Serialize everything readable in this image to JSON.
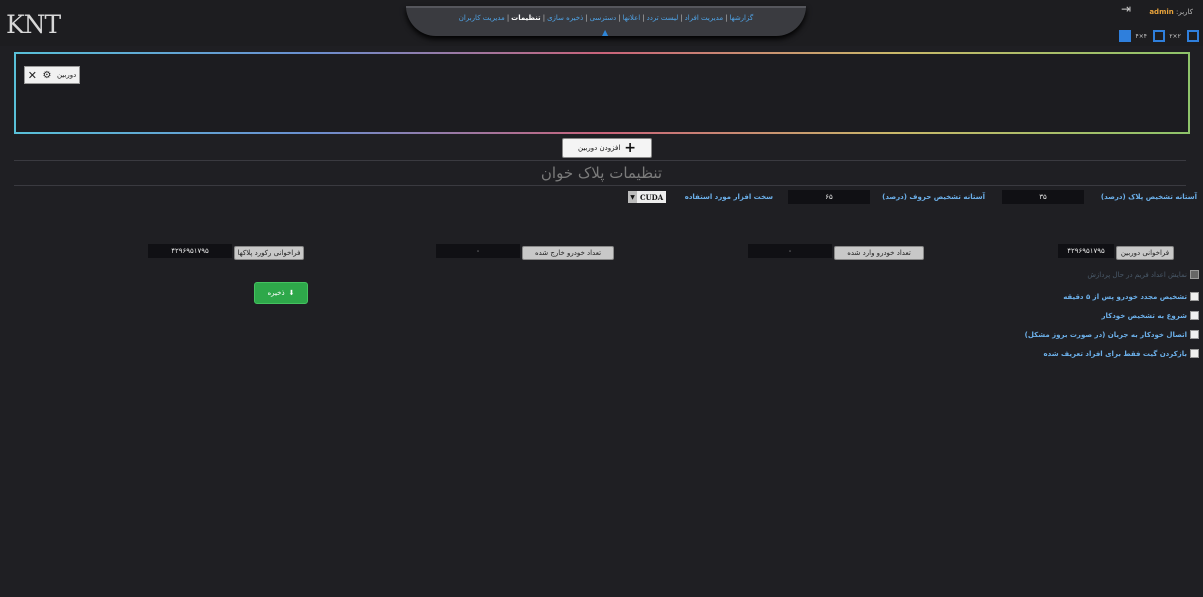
{
  "header": {
    "logo": "KNT",
    "nav_items": [
      "گزارشها",
      "مدیریت افراد",
      "لیست تردد",
      "اعلانها",
      "دسترسی",
      "ذخیره سازی",
      "تنظیمات",
      "مدیریت کاربران"
    ],
    "active_index": 6,
    "home_icon": "home-icon",
    "user_label": "کاربر:",
    "user_name": "admin",
    "logout_icon": "logout-icon",
    "layout_buttons": [
      "layout-1x1",
      "layout-2x2",
      "layout-3x3"
    ],
    "layout_labels": [
      "۴×۴",
      "۲×۲"
    ]
  },
  "cameras": {
    "tab_label": "دوربین",
    "add_button_label": "افزودن دوربین"
  },
  "plate_settings": {
    "title": "تنظیمات پلاک خوان",
    "plate_threshold_label": "آستانه تشخیص پلاک (درصد)",
    "plate_threshold_value": "۳۵",
    "char_threshold_label": "آستانه تشخیص حروف (درصد)",
    "char_threshold_value": "۶۵",
    "hardware_label": "سخت افزار مورد استفاده",
    "hardware_value": "CUDA",
    "last_camera_label": "فراخوانی دوربین",
    "last_camera_value": "۴۲۹۶۹۵۱۷۹۵",
    "entered_cars_label": "تعداد خودرو وارد شده",
    "entered_cars_value": "۰",
    "exited_cars_label": "تعداد خودرو خارج شده",
    "exited_cars_value": "۰",
    "last_record_label": "فراخوانی رکورد پلاکها",
    "last_record_value": "۴۲۹۶۹۵۱۷۹۵"
  },
  "options": [
    {
      "label": "نمایش اعداد فریم در حال پردازش",
      "checked": false,
      "disabled": true
    },
    {
      "label": "تشخیص مجدد خودرو پس از ۵ دقیقه",
      "checked": false,
      "disabled": false
    },
    {
      "label": "شروع به تشخیص خودکار",
      "checked": false,
      "disabled": false
    },
    {
      "label": "اتصال خودکار به جریان (در صورت بروز مشکل)",
      "checked": false,
      "disabled": false
    },
    {
      "label": "بازکردن گیت فقط برای افراد تعریف شده",
      "checked": false,
      "disabled": false
    }
  ],
  "save_button_label": "ذخیره",
  "colors": {
    "accent": "#2f7fdc",
    "label": "#6cb0ea",
    "save": "#2ea84a"
  }
}
